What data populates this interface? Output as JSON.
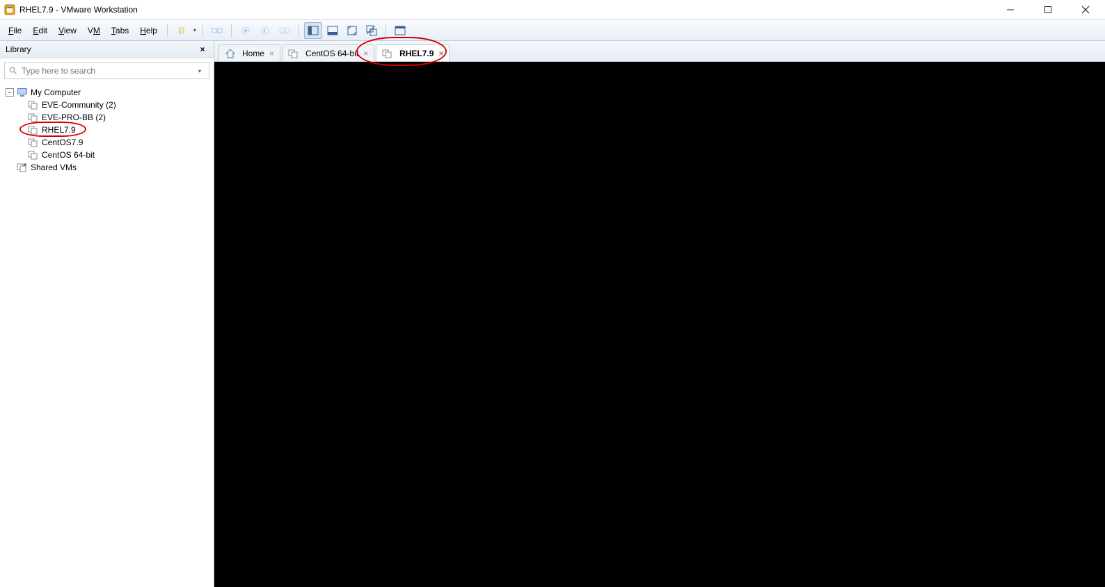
{
  "window": {
    "title": "RHEL7.9 - VMware Workstation"
  },
  "menus": {
    "file": "File",
    "edit": "Edit",
    "view": "View",
    "vm": "VM",
    "tabs": "Tabs",
    "help": "Help"
  },
  "sidebar": {
    "header": "Library",
    "search_placeholder": "Type here to search",
    "root": "My Computer",
    "items": [
      {
        "label": "EVE-Community (2)"
      },
      {
        "label": "EVE-PRO-BB (2)"
      },
      {
        "label": "RHEL7.9"
      },
      {
        "label": "CentOS7.9"
      },
      {
        "label": "CentOS 64-bit"
      }
    ],
    "shared": "Shared VMs"
  },
  "tabs": [
    {
      "label": "Home",
      "type": "home",
      "active": false
    },
    {
      "label": "CentOS 64-bit",
      "type": "vm",
      "active": false
    },
    {
      "label": "RHEL7.9",
      "type": "vm",
      "active": true
    }
  ]
}
